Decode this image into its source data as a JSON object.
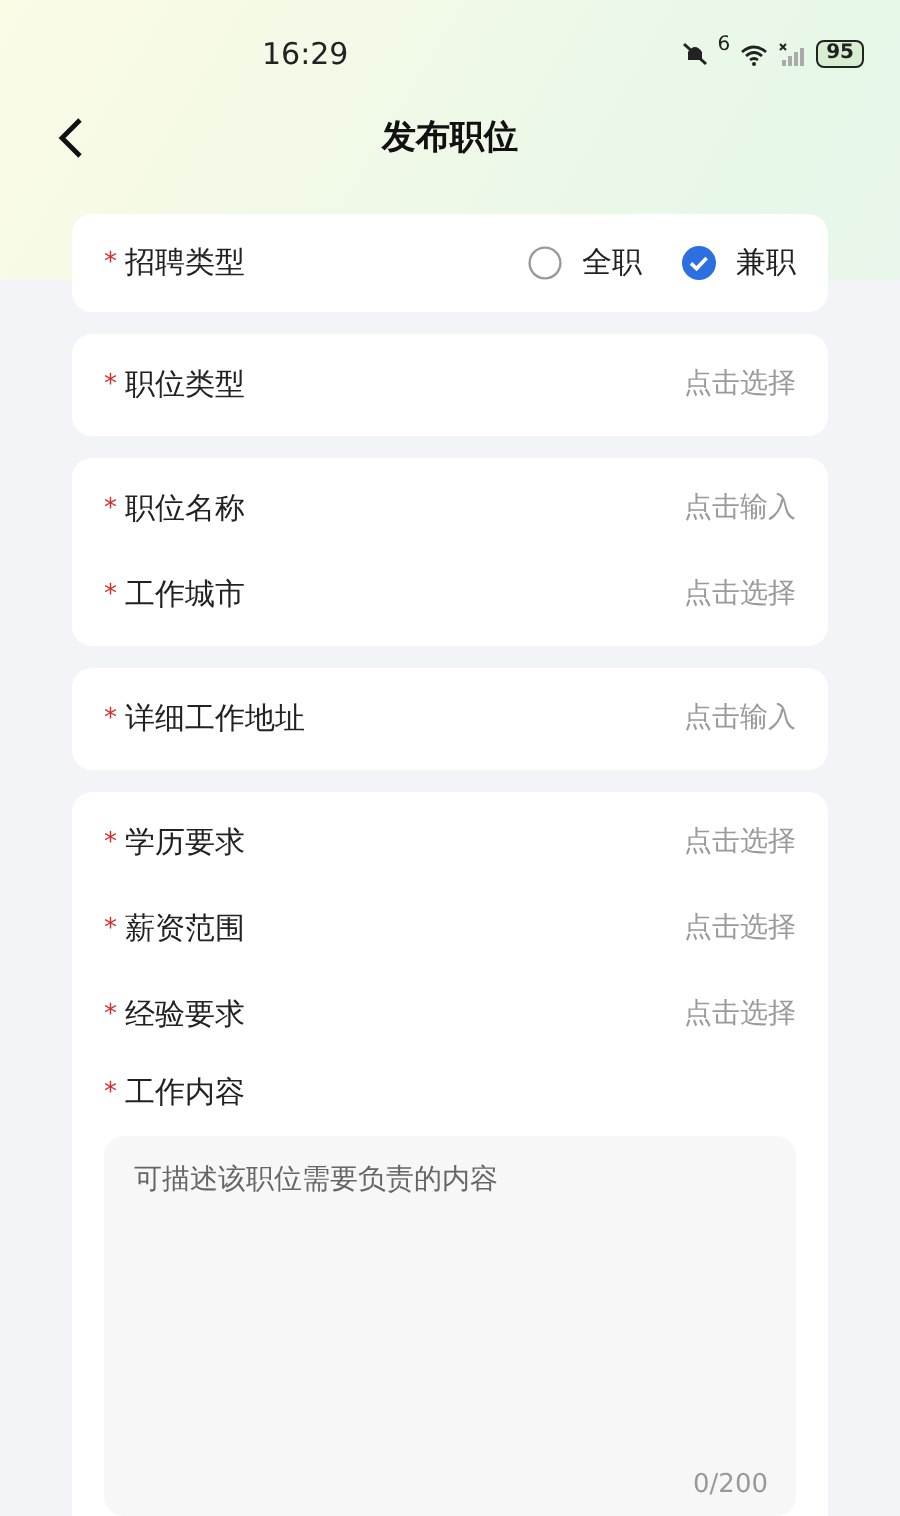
{
  "status_bar": {
    "time": "16:29",
    "network_badge": "6",
    "battery": "95"
  },
  "header": {
    "title": "发布职位"
  },
  "recruit_type": {
    "label": "招聘类型",
    "mark": "*",
    "options": [
      {
        "label": "全职",
        "selected": false
      },
      {
        "label": "兼职",
        "selected": true
      }
    ]
  },
  "groups": [
    [
      {
        "label": "职位类型",
        "mark": "*",
        "placeholder": "点击选择"
      }
    ],
    [
      {
        "label": "职位名称",
        "mark": "*",
        "placeholder": "点击输入"
      },
      {
        "label": "工作城市",
        "mark": "*",
        "placeholder": "点击选择"
      }
    ],
    [
      {
        "label": "详细工作地址",
        "mark": "*",
        "placeholder": "点击输入"
      }
    ]
  ],
  "details": {
    "fields": [
      {
        "label": "学历要求",
        "mark": "*",
        "placeholder": "点击选择"
      },
      {
        "label": "薪资范围",
        "mark": "*",
        "placeholder": "点击选择"
      },
      {
        "label": "经验要求",
        "mark": "*",
        "placeholder": "点击选择"
      }
    ],
    "content": {
      "label": "工作内容",
      "mark": "*",
      "placeholder": "可描述该职位需要负责的内容",
      "counter": "0/200"
    }
  }
}
